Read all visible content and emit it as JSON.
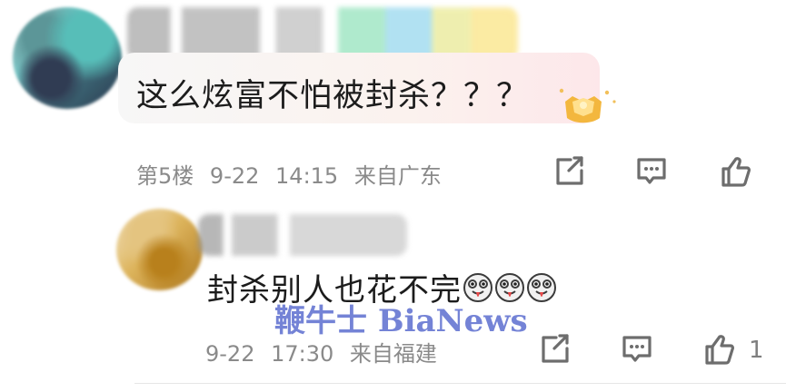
{
  "comment": {
    "text": "这么炫富不怕被封杀？？？",
    "floor": "第5楼",
    "date": "9-22",
    "time": "14:15",
    "location": "来自广东"
  },
  "reply": {
    "text": "封杀别人也花不完",
    "emoji": [
      "dog-tongue-emoji",
      "dog-tongue-emoji",
      "dog-tongue-emoji"
    ],
    "date": "9-22",
    "time": "17:30",
    "location": "来自福建",
    "like_count": "1"
  },
  "watermark": {
    "text": "鞭牛士 BiaNews"
  },
  "icons": {
    "share": "share-icon",
    "reply": "comment-icon",
    "like": "thumbs-up-icon",
    "badge": "crown-badge-icon"
  },
  "colors": {
    "meta_text": "#8a8a8a",
    "watermark": "#4b5ec8",
    "badge": "#f3b73e"
  }
}
